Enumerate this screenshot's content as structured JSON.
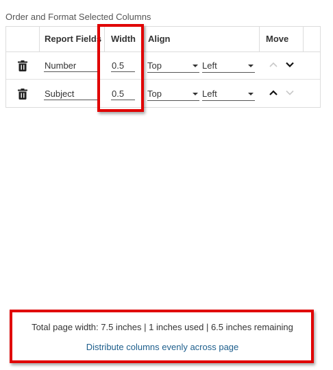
{
  "section_title": "Order and Format Selected Columns",
  "table": {
    "headers": {
      "report_fields": "Report Fields",
      "width": "Width",
      "align": "Align",
      "move": "Move"
    },
    "rows": [
      {
        "field": "Number",
        "width": "0.5",
        "valign": "Top",
        "halign": "Left",
        "move_up_enabled": false,
        "move_down_enabled": true
      },
      {
        "field": "Subject",
        "width": "0.5",
        "valign": "Top",
        "halign": "Left",
        "move_up_enabled": true,
        "move_down_enabled": false
      }
    ]
  },
  "footer": {
    "summary": "Total page width:  7.5 inches | 1 inches used | 6.5 inches remaining",
    "distribute_link": "Distribute columns evenly across page"
  },
  "colors": {
    "highlight": "#e00000",
    "link": "#1d5e8c",
    "disabled_chevron": "#c8c8c8"
  }
}
